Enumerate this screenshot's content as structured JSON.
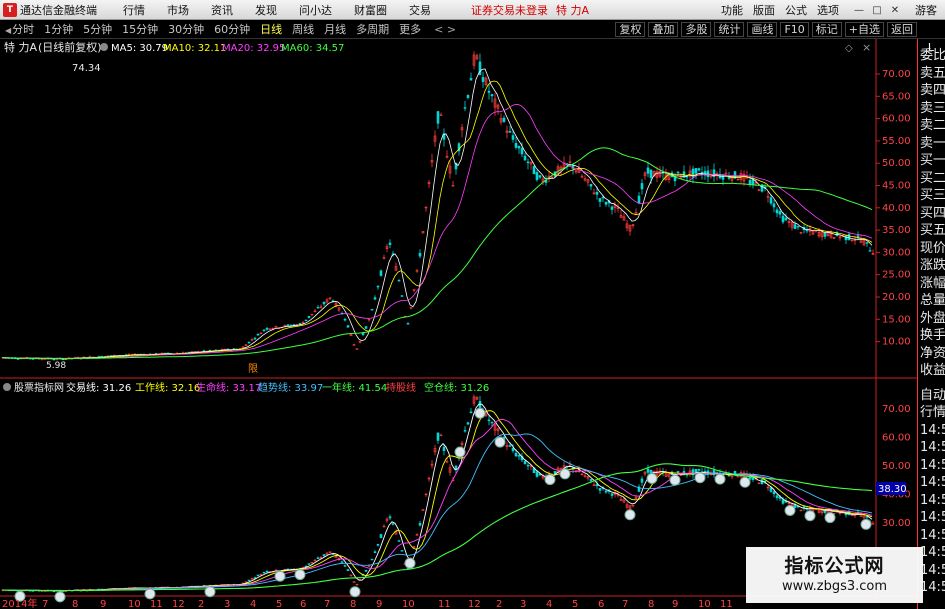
{
  "app": {
    "name": "通达信金融终端",
    "logo_text": "T",
    "menu": [
      "行情",
      "市场",
      "资讯",
      "发现",
      "问小达",
      "财富圈",
      "交易"
    ],
    "login_status": "证券交易未登录",
    "stock_title": "特 力A",
    "right_menu": [
      "功能",
      "版面",
      "公式",
      "选项"
    ],
    "guest": "游客"
  },
  "periods": {
    "items": [
      "分时",
      "1分钟",
      "5分钟",
      "15分钟",
      "30分钟",
      "60分钟",
      "日线",
      "周线",
      "月线",
      "多周期",
      "更多"
    ],
    "active": "日线",
    "arrows": "< >"
  },
  "toolbar": [
    "复权",
    "叠加",
    "多股",
    "统计",
    "画线",
    "F10",
    "标记",
    "+自选",
    "返回"
  ],
  "main_panel": {
    "stock": "特 力A",
    "mode": "(日线前复权)",
    "indicators": [
      {
        "label": "MA5: 30.79",
        "color": "#ffffff"
      },
      {
        "label": "MA10: 32.11",
        "color": "#ffff00"
      },
      {
        "label": "MA20: 32.95",
        "color": "#ff40ff"
      },
      {
        "label": "MA60: 34.57",
        "color": "#40ff40"
      }
    ],
    "price_axis": [
      "70.00",
      "65.00",
      "60.00",
      "55.00",
      "50.00",
      "45.00",
      "40.00",
      "35.00",
      "30.00",
      "25.00",
      "20.00",
      "15.00",
      "10.00"
    ],
    "high_label": "74.34",
    "low_label": "5.98",
    "event_marker": "限"
  },
  "sub_panel": {
    "name": "股票指标网",
    "indicators": [
      {
        "label": "交易线: 31.26",
        "color": "#ffffff"
      },
      {
        "label": "工作线: 32.16",
        "color": "#ffff00"
      },
      {
        "label": "生命线: 33.17",
        "color": "#ff40ff"
      },
      {
        "label": "趋势线: 33.97",
        "color": "#40c0ff"
      },
      {
        "label": "一年线: 41.54",
        "color": "#40ff40"
      },
      {
        "label": "持股线",
        "color": "#ff4040"
      },
      {
        "label": "空仓线: 31.26",
        "color": "#40ff40"
      }
    ],
    "price_axis": [
      "70.00",
      "60.00",
      "50.00",
      "40.00",
      "30.00"
    ],
    "current_price": "38.30"
  },
  "x_axis": [
    "2014年",
    "7",
    "8",
    "9",
    "10",
    "11",
    "12",
    "2",
    "3",
    "4",
    "5",
    "6",
    "7",
    "8",
    "9",
    "10",
    "11",
    "12",
    "2",
    "3",
    "4",
    "5",
    "6",
    "7",
    "8",
    "9",
    "10",
    "11"
  ],
  "side_panel": {
    "top_label": "L",
    "upper": [
      "委比",
      "卖五",
      "卖四",
      "卖三",
      "卖二",
      "卖一",
      "买一",
      "买二",
      "买三",
      "买四",
      "买五",
      "现价",
      "涨跌",
      "涨幅",
      "总量",
      "外盘",
      "换手",
      "净资",
      "收益"
    ],
    "lower": [
      "自动",
      "行情",
      "14:5",
      "14:5",
      "14:5",
      "14:5",
      "14:5",
      "14:5",
      "14:5",
      "14:5",
      "14:5",
      "14:5"
    ]
  },
  "watermark": {
    "title": "指标公式网",
    "url": "www.zbgs3.com"
  },
  "colors": {
    "up": "#ff3c3c",
    "down": "#00d8d8",
    "axis": "#ff3333",
    "ma60": "#40ff40"
  }
}
